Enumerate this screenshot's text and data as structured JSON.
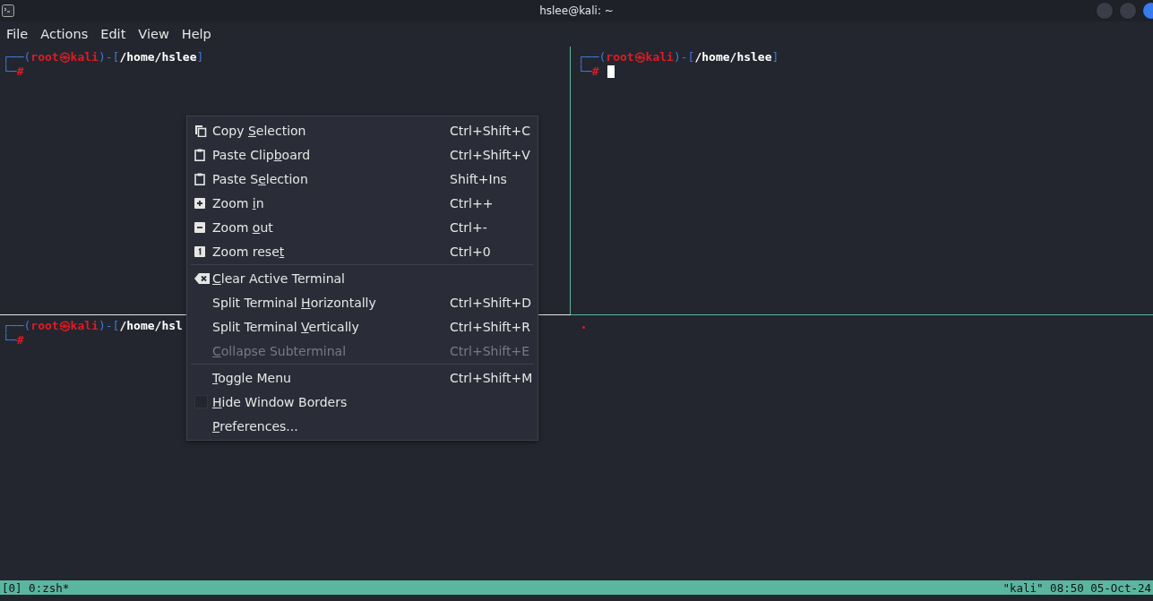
{
  "window": {
    "title": "hslee@kali: ~"
  },
  "menubar": [
    {
      "label": "File"
    },
    {
      "label": "Actions"
    },
    {
      "label": "Edit"
    },
    {
      "label": "View"
    },
    {
      "label": "Help"
    }
  ],
  "panes": [
    {
      "lines": [
        [
          {
            "text": "┌──(",
            "kind": "frame"
          },
          {
            "text": "root㉿kali",
            "kind": "user"
          },
          {
            "text": ")-[",
            "kind": "frame"
          },
          {
            "text": "/home/hslee",
            "kind": "path"
          },
          {
            "text": "]",
            "kind": "frame"
          }
        ],
        [
          {
            "text": "└─",
            "kind": "frame"
          },
          {
            "text": "#",
            "kind": "user"
          }
        ]
      ],
      "cursor": false
    },
    {
      "lines": [
        [
          {
            "text": "┌──(",
            "kind": "frame"
          },
          {
            "text": "root㉿kali",
            "kind": "user"
          },
          {
            "text": ")-[",
            "kind": "frame"
          },
          {
            "text": "/home/hslee",
            "kind": "path"
          },
          {
            "text": "]",
            "kind": "frame"
          }
        ],
        [
          {
            "text": "└─",
            "kind": "frame"
          },
          {
            "text": "#",
            "kind": "user"
          }
        ]
      ],
      "cursor": true
    },
    {
      "lines": [
        [
          {
            "text": "┌──(",
            "kind": "frame"
          },
          {
            "text": "root㉿kali",
            "kind": "user"
          },
          {
            "text": ")-[",
            "kind": "frame"
          },
          {
            "text": "/home/hsl",
            "kind": "path"
          }
        ],
        [
          {
            "text": "└─",
            "kind": "frame"
          },
          {
            "text": "#",
            "kind": "user"
          }
        ]
      ],
      "cursor": false
    }
  ],
  "context_menu": {
    "sections": [
      [
        {
          "kind": "copy",
          "label_before": "Copy ",
          "mnemonic": "S",
          "label_after": "election",
          "shortcut": "Ctrl+Shift+C",
          "disabled": false
        },
        {
          "kind": "paste",
          "label_before": "Paste Clip",
          "mnemonic": "b",
          "label_after": "oard",
          "shortcut": "Ctrl+Shift+V",
          "disabled": false
        },
        {
          "kind": "paste",
          "label_before": "Paste S",
          "mnemonic": "e",
          "label_after": "lection",
          "shortcut": "Shift+Ins",
          "disabled": false
        },
        {
          "kind": "zoomin",
          "label_before": "Zoom ",
          "mnemonic": "i",
          "label_after": "n",
          "shortcut": "Ctrl++",
          "disabled": false
        },
        {
          "kind": "zoomout",
          "label_before": "Zoom ",
          "mnemonic": "o",
          "label_after": "ut",
          "shortcut": "Ctrl+-",
          "disabled": false
        },
        {
          "kind": "zoomreset",
          "label_before": "Zoom rese",
          "mnemonic": "t",
          "shortcut": "Ctrl+0",
          "disabled": false
        }
      ],
      [
        {
          "kind": "clear",
          "mnemonic": "C",
          "label_after": "lear Active Terminal",
          "disabled": false
        },
        {
          "kind": "plain",
          "label_before": "Split Terminal ",
          "mnemonic": "H",
          "label_after": "orizontally",
          "shortcut": "Ctrl+Shift+D",
          "disabled": false
        },
        {
          "kind": "plain",
          "label_before": "Split Terminal ",
          "mnemonic": "V",
          "label_after": "ertically",
          "shortcut": "Ctrl+Shift+R",
          "disabled": false
        },
        {
          "kind": "plain",
          "mnemonic": "C",
          "label_after": "ollapse Subterminal",
          "shortcut": "Ctrl+Shift+E",
          "disabled": true
        }
      ],
      [
        {
          "kind": "plain",
          "mnemonic": "T",
          "label_after": "oggle Menu",
          "shortcut": "Ctrl+Shift+M",
          "disabled": false
        },
        {
          "kind": "check",
          "checked": false,
          "mnemonic": "H",
          "label_after": "ide Window Borders",
          "disabled": false
        },
        {
          "kind": "plain",
          "mnemonic": "P",
          "label_after": "references...",
          "disabled": false
        }
      ]
    ]
  },
  "status_bar": {
    "left": "[0] 0:zsh*",
    "right": "\"kali\" 08:50 05-Oct-24"
  }
}
